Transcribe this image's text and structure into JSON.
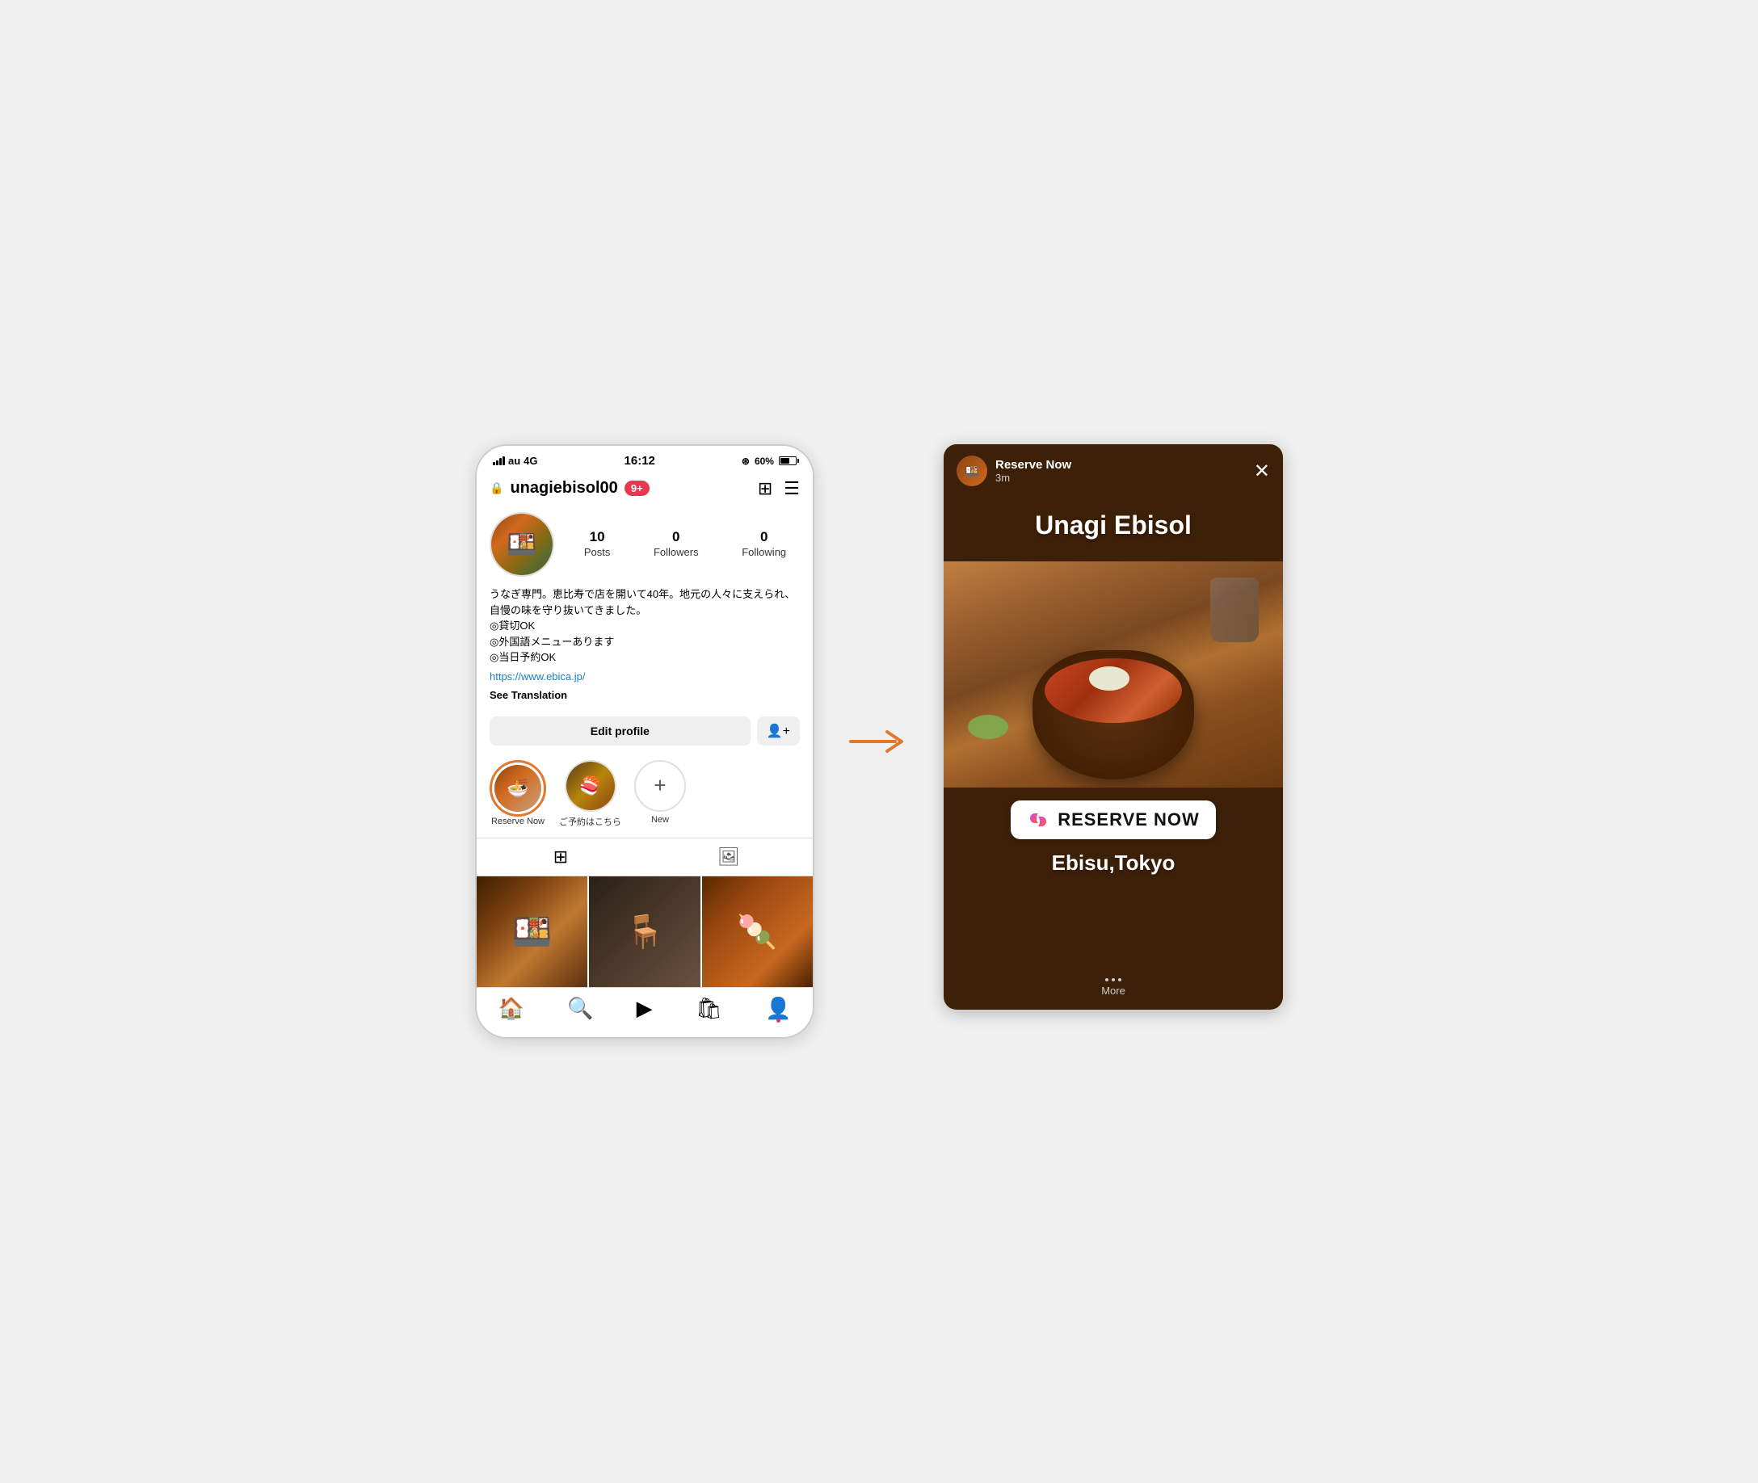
{
  "statusBar": {
    "carrier": "au",
    "network": "4G",
    "time": "16:12",
    "battery": "60%"
  },
  "profile": {
    "username": "unagiebisol00",
    "notificationBadge": "9+",
    "stats": {
      "posts": {
        "number": "10",
        "label": "Posts"
      },
      "followers": {
        "number": "0",
        "label": "Followers"
      },
      "following": {
        "number": "0",
        "label": "Following"
      }
    },
    "bio": "うなぎ専門。恵比寿で店を開いて40年。地元の人々に支えられ、自慢の味を守り抜いてきました。\n◎貸切OK\n◎外国語メニューあります\n◎当日予約OK",
    "link": "https://www.ebica.jp/",
    "seeTranslation": "See Translation",
    "editProfileButton": "Edit profile",
    "highlights": [
      {
        "label": "Reserve Now",
        "hasImage": true
      },
      {
        "label": "ご予約はこちら",
        "hasImage": true
      },
      {
        "label": "New",
        "hasImage": false
      }
    ]
  },
  "tabs": {
    "grid": "grid",
    "tagged": "tagged"
  },
  "bottomNav": {
    "home": "🏠",
    "search": "🔍",
    "reels": "▶",
    "shop": "🛍",
    "profile": "👤"
  },
  "story": {
    "username": "Reserve Now",
    "time": "3m",
    "restaurantName": "Unagi Ebisol",
    "reserveBadgeText": "RESERVE NOW",
    "location": "Ebisu,Tokyo",
    "more": "More",
    "closeButton": "✕"
  }
}
